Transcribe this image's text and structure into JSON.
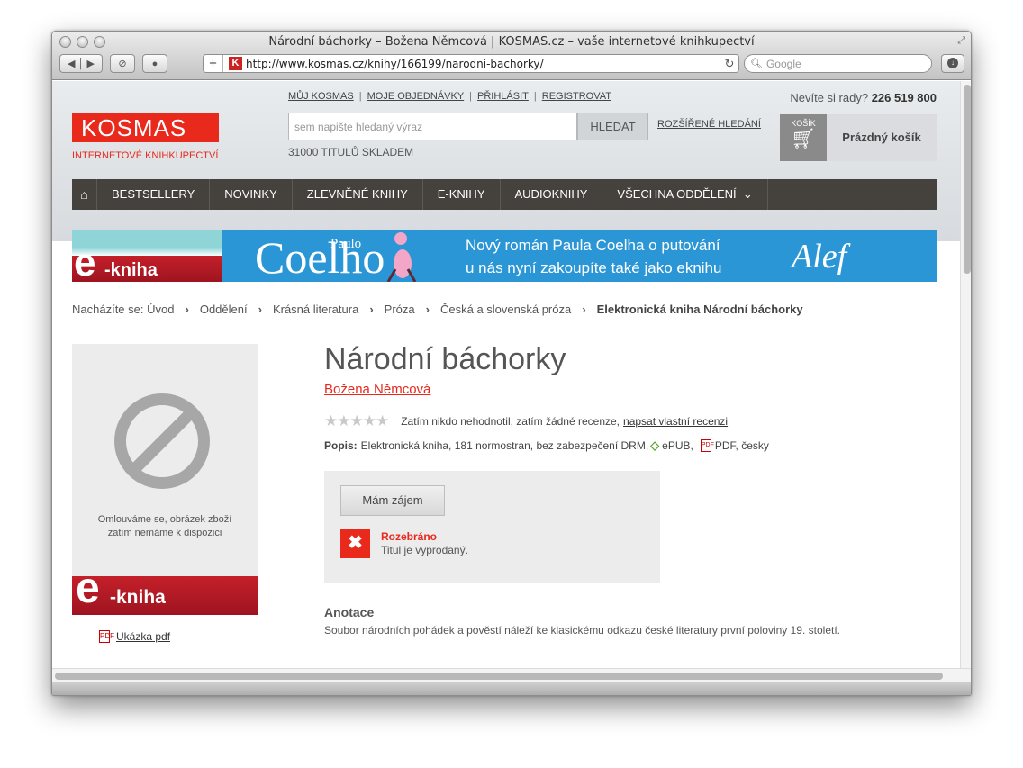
{
  "browser": {
    "window_title": "Národní báchorky – Božena Němcová | KOSMAS.cz – vaše internetové knihkupectví",
    "url": "http://www.kosmas.cz/knihy/166199/narodni-bachorky/",
    "search_placeholder": "Google",
    "favicon_letter": "K",
    "new_tab": "+"
  },
  "header": {
    "logo": "KOSMAS",
    "logo_sub": "INTERNETOVÉ KNIHKUPECTVÍ",
    "links": [
      "MŮJ KOSMAS",
      "MOJE OBJEDNÁVKY",
      "PŘIHLÁSIT",
      "REGISTROVAT"
    ],
    "link_sep": "|",
    "phone_label": "Nevíte si rady?",
    "phone_number": "226 519 800",
    "search_placeholder": "sem napište hledaný výraz",
    "search_button": "HLEDAT",
    "advanced_search": "ROZŠÍŘENÉ HLEDÁNÍ",
    "stock_text": "31000 TITULŮ SKLADEM",
    "cart_label": "KOŠÍK",
    "cart_status": "Prázdný košík"
  },
  "nav": {
    "items": [
      "BESTSELLERY",
      "NOVINKY",
      "ZLEVNĚNÉ KNIHY",
      "E-KNIHY",
      "AUDIOKNIHY",
      "VŠECHNA ODDĚLENÍ"
    ]
  },
  "banner": {
    "e": "e",
    "kniha": "-kniha",
    "paulo": "Paulo",
    "coelho": "Coelho",
    "line1": "Nový román Paula Coelha o putování",
    "line2": "u nás nyní zakoupíte také jako eknihu",
    "publisher": "Alef"
  },
  "breadcrumb": {
    "prefix": "Nacházíte se:",
    "items": [
      "Úvod",
      "Oddělení",
      "Krásná literatura",
      "Próza",
      "Česká a slovenská próza"
    ],
    "current": "Elektronická kniha Národní báchorky",
    "sep": "›"
  },
  "product": {
    "noimage_line1": "Omlouváme se, obrázek zboží",
    "noimage_line2": "zatím nemáme k dispozici",
    "ebook_e": "e",
    "ebook_kniha": "-kniha",
    "sample_pdf": "Ukázka pdf",
    "title": "Národní báchorky",
    "author": "Božena Němcová",
    "stars": "★★★★★",
    "rating_text": "Zatím nikdo nehodnotil, zatím žádné recenze,",
    "rating_link": "napsat vlastní recenzi",
    "desc_label": "Popis:",
    "desc_text": "Elektronická kniha, 181 normostran, bez zabezpečení DRM,",
    "format_epub": "ePUB,",
    "format_pdf": "PDF, česky",
    "interest_button": "Mám zájem",
    "status_title": "Rozebráno",
    "status_text": "Titul je vyprodaný.",
    "annotation_title": "Anotace",
    "annotation_text": "Soubor národních pohádek a pověstí náleží ke klasickému odkazu české literatury první poloviny 19. století."
  }
}
